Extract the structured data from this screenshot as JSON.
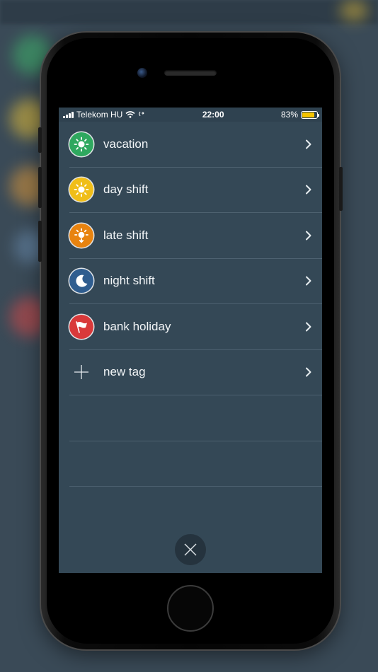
{
  "status_bar": {
    "carrier": "Telekom HU",
    "time": "22:00",
    "battery_percent": "83%",
    "battery_level": 0.83,
    "battery_color": "#f5c400"
  },
  "tags": [
    {
      "label": "vacation",
      "icon": "sun-icon",
      "color": "#2fa85f"
    },
    {
      "label": "day shift",
      "icon": "sun-icon",
      "color": "#f0be19"
    },
    {
      "label": "late shift",
      "icon": "sunset-icon",
      "color": "#e8830f"
    },
    {
      "label": "night shift",
      "icon": "moon-icon",
      "color": "#2f5d8f"
    },
    {
      "label": "bank holiday",
      "icon": "flag-icon",
      "color": "#d9393a"
    }
  ],
  "new_tag": {
    "label": "new tag",
    "icon": "plus-icon"
  },
  "close": {
    "icon": "close-icon"
  }
}
